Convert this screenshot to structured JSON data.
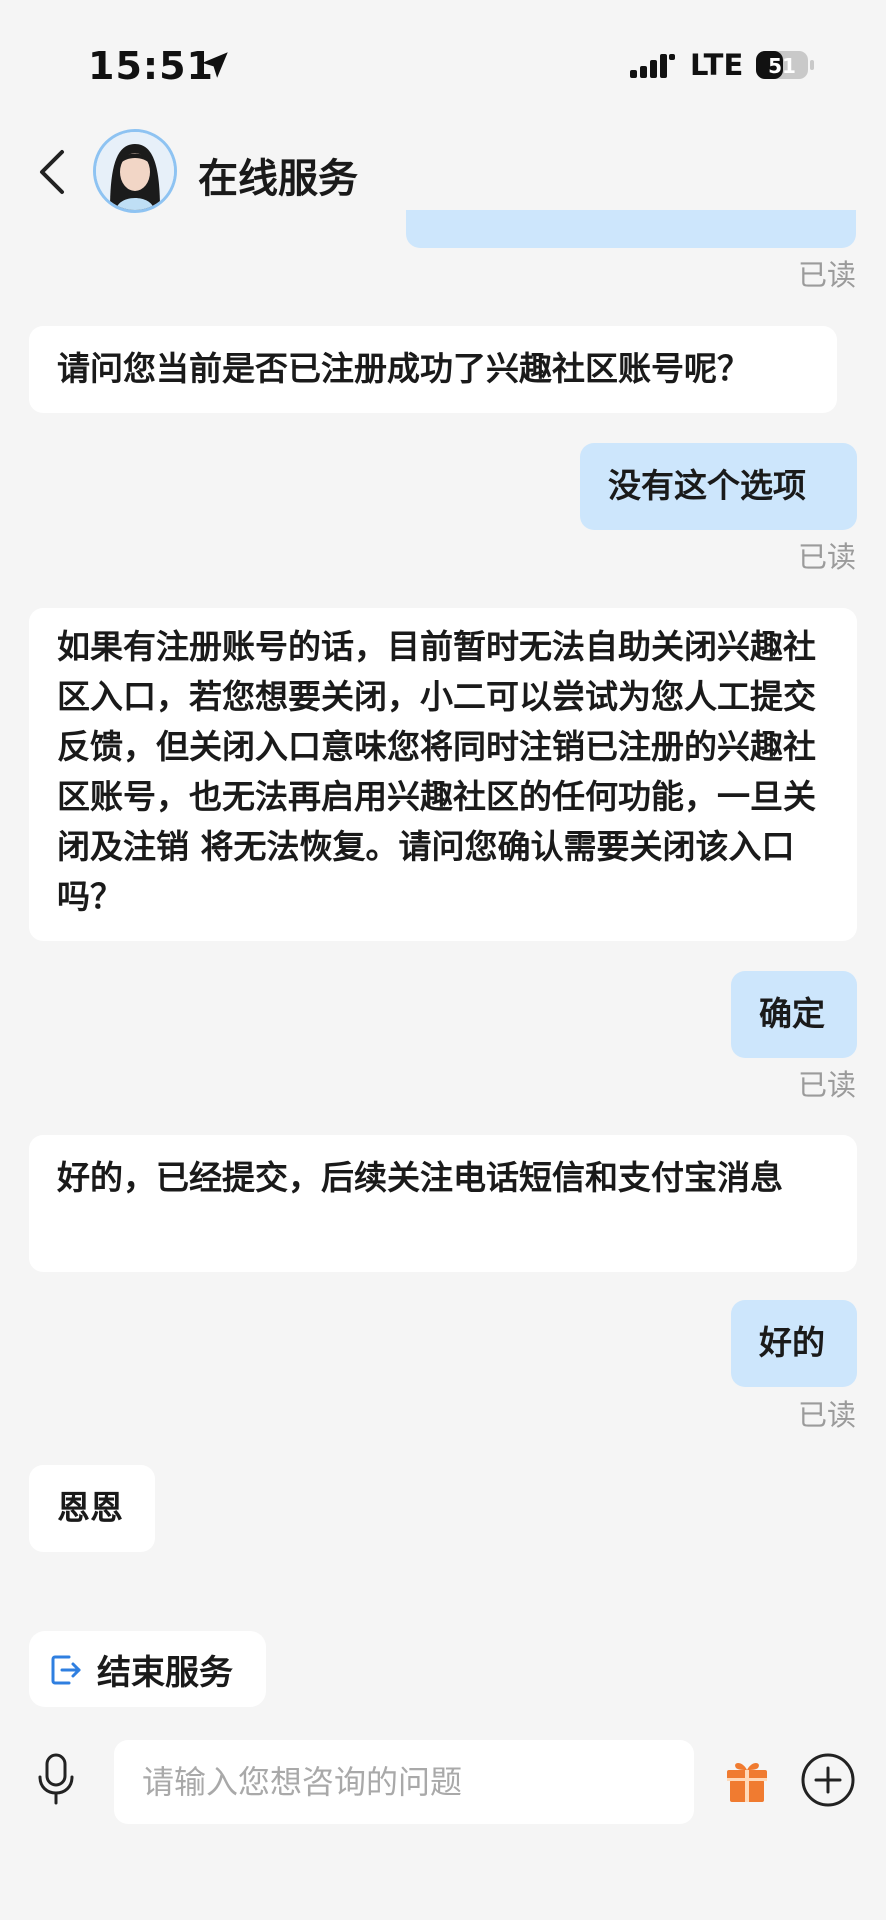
{
  "status": {
    "time": "15:51",
    "network": "LTE",
    "battery": "51"
  },
  "header": {
    "title": "在线服务"
  },
  "messages": [
    {
      "from": "agent",
      "text": "请问您当前是否已注册成功了兴趣社区账号呢？"
    },
    {
      "from": "user",
      "text": "没有这个选项",
      "status": "已读"
    },
    {
      "from": "agent",
      "text": "如果有注册账号的话，目前暂时无法自助关闭兴趣社区入口，若您想要关闭，小二可以尝试为您人工提交反馈，但关闭入口意味您将同时注销已注册的兴趣社区账号，也无法再启用兴趣社区的任何功能，一旦关闭及注销 将无法恢复。请问您确认需要关闭该入口吗？"
    },
    {
      "from": "user",
      "text": "确定",
      "status": "已读"
    },
    {
      "from": "agent",
      "text": "好的，已经提交，后续关注电话短信和支付宝消息"
    },
    {
      "from": "user",
      "text": "好的",
      "status": "已读"
    },
    {
      "from": "agent",
      "text": "恩恩"
    }
  ],
  "top_read_status": "已读",
  "actions": {
    "end_service_label": "结束服务"
  },
  "input": {
    "placeholder": "请输入您想咨询的问题"
  },
  "colors": {
    "user_bubble": "#cde6fc",
    "agent_bubble": "#ffffff",
    "background": "#f5f5f5",
    "gift": "#f07b30",
    "accent_blue": "#2f7fe0"
  }
}
